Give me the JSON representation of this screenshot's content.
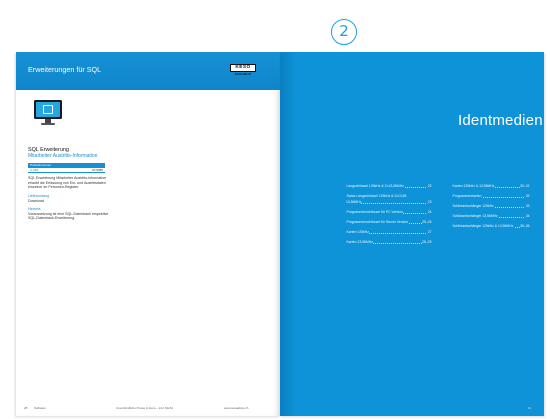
{
  "marker": "2",
  "left_page": {
    "title": "Erweiterungen für SQL",
    "logo_keso": "KESO",
    "logo_assa": "ASSA ABLOY",
    "product_title": "SQL Erweiterung",
    "product_subtitle": "Mitarbeiter Austritts-Information",
    "table_header": "Produktnummer",
    "table_row_label": "A-SMI",
    "table_row_value": "ST.5085",
    "description_lines": [
      "SQL Erweiterung Mitarbeiter Austritts-Information",
      "erlaubt die Erfassung von Ein- und Austrittsdaten",
      "einzelner im Personen-Register."
    ],
    "delivery_label": "Lieferumfang",
    "delivery_value": "Download",
    "note_label": "Hinweis",
    "note_lines": [
      "Voraussetzung ist eine SQL-Datenbank respektive",
      "SQL-Datenbank-Erweiterung."
    ],
    "footer_page": "28",
    "footer_section": "Software",
    "footer_center": "Unverbindliche Preise in Euro – inkl. MwSt.",
    "footer_right": "www.assaabloy.ch"
  },
  "right_page": {
    "title": "Identmedien",
    "tab": "2",
    "toc_left": [
      {
        "title": "Langschlüssel 125kHz & 2×13,56MHz",
        "page": "22"
      },
      {
        "title": "Swiss Langschlüssel 125kHz & 2x13,56",
        "title2": "13,56MHz",
        "page": "23"
      },
      {
        "title": "Programmierschlüssel für PC Version",
        "page": "24"
      },
      {
        "title": "Programmierschlüssel für Server Version",
        "page": "25–26"
      },
      {
        "title": "Karten 125kHz",
        "page": "27"
      },
      {
        "title": "Karten 13,56MHz",
        "page": "28–29"
      }
    ],
    "toc_right": [
      {
        "title": "Karten 125kHz & 13,56MHz",
        "page": "30–31"
      },
      {
        "title": "Programmierkarten",
        "page": "32"
      },
      {
        "title": "Schlüsselanhänger 125kHz",
        "page": "33"
      },
      {
        "title": "Schlüsselanhänger 13,56MHz",
        "page": "34"
      },
      {
        "title": "Schlüsselanhänger 125kHz & 13,56MHz",
        "page": "35–36"
      }
    ],
    "footer_page": "11"
  },
  "colors": {
    "brand_blue": "#0e93d8",
    "title_bar": "#1790d4"
  }
}
